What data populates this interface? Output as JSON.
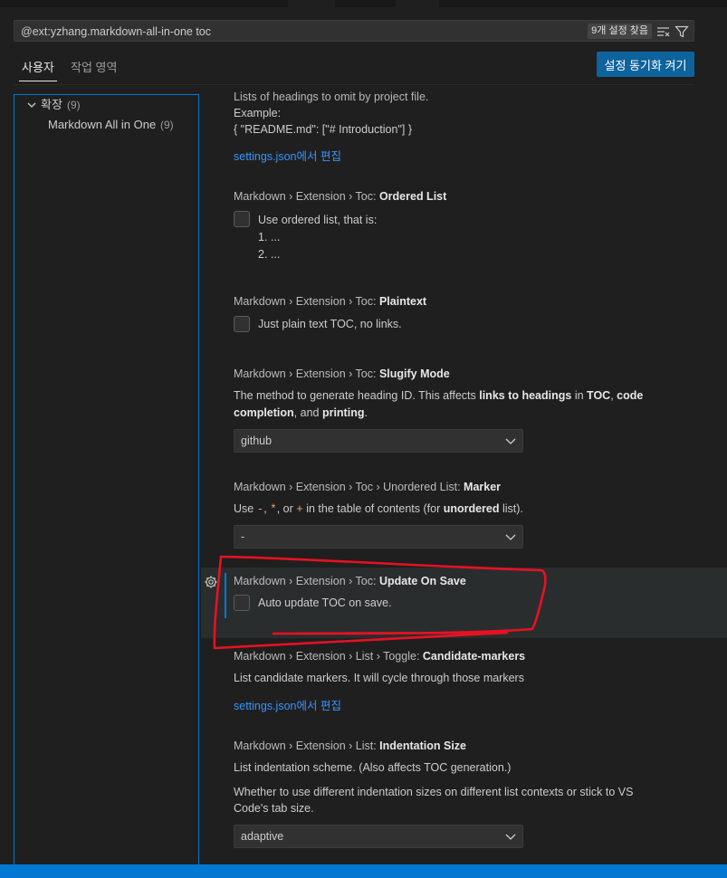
{
  "search": {
    "query": "@ext:yzhang.markdown-all-in-one toc",
    "result_count": "9개 설정 찾음"
  },
  "tabs": [
    {
      "label": "사용자",
      "active": true
    },
    {
      "label": "작업 영역",
      "active": false
    }
  ],
  "sync_button": "설정 동기화 켜기",
  "toc": {
    "group": {
      "label": "확장",
      "count": "(9)"
    },
    "item": {
      "label": "Markdown All in One",
      "count": "(9)"
    }
  },
  "settings": {
    "omit_partial": {
      "desc": "Lists of headings to omit by project file.",
      "example_label": "Example:",
      "example_value": "{ \"README.md\": [\"# Introduction\"] }",
      "link": "settings.json에서 편집"
    },
    "ordered_list": {
      "category": "Markdown › Extension › Toc: ",
      "name": "Ordered List",
      "label": "Use ordered list, that is:",
      "line1": "1. ...",
      "line2": "2. ...",
      "checked": false
    },
    "plaintext": {
      "category": "Markdown › Extension › Toc: ",
      "name": "Plaintext",
      "label": "Just plain text TOC, no links.",
      "checked": false
    },
    "slugify": {
      "category": "Markdown › Extension › Toc: ",
      "name": "Slugify Mode",
      "desc_1": "The method to generate heading ID. This affects ",
      "desc_b1": "links to headings",
      "desc_2": " in ",
      "desc_b2": "TOC",
      "desc_3": ", ",
      "desc_b3": "code",
      "desc_b4": "completion",
      "desc_4": ", and ",
      "desc_b5": "printing",
      "desc_5": ".",
      "value": "github"
    },
    "marker": {
      "category": "Markdown › Extension › Toc › Unordered List: ",
      "name": "Marker",
      "desc_1": "Use ",
      "code1": "-",
      "desc_2": ", ",
      "code2": "*",
      "desc_3": ", or ",
      "code3": "+",
      "desc_4": " in the table of contents (for ",
      "desc_b": "unordered",
      "desc_5": " list).",
      "value": "-"
    },
    "update_on_save": {
      "category": "Markdown › Extension › Toc: ",
      "name": "Update On Save",
      "label": "Auto update TOC on save.",
      "checked": false
    },
    "candidate_markers": {
      "category": "Markdown › Extension › List › Toggle: ",
      "name": "Candidate-markers",
      "desc": "List candidate markers. It will cycle through those markers",
      "link": "settings.json에서 편집"
    },
    "indentation": {
      "category": "Markdown › Extension › List: ",
      "name": "Indentation Size",
      "desc1": "List indentation scheme. (Also affects TOC generation.)",
      "desc2": "Whether to use different indentation sizes on different list contexts or stick to VS",
      "desc3": "Code's tab size.",
      "value": "adaptive"
    }
  },
  "colors": {
    "accent": "#0078d4",
    "link": "#3794ff",
    "annotation": "#e81123"
  }
}
